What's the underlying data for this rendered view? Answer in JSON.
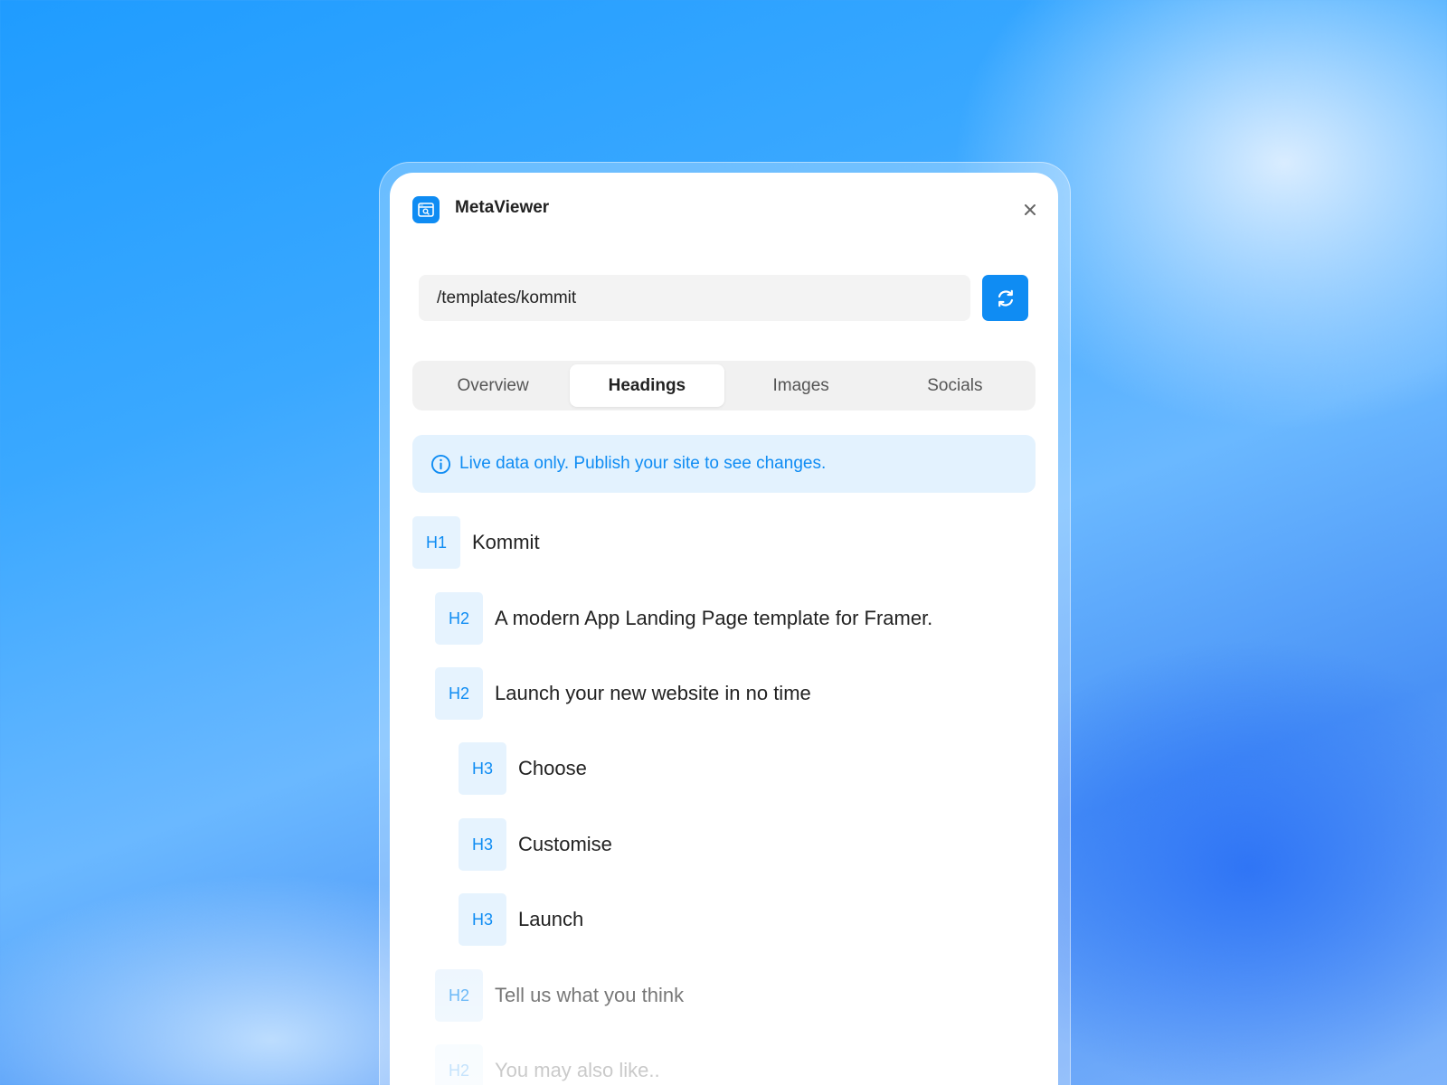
{
  "app": {
    "title": "MetaViewer",
    "icon": "browser-search-icon",
    "accent_color": "#0f8cf3"
  },
  "url_bar": {
    "value": "/templates/kommit"
  },
  "tabs": [
    {
      "label": "Overview",
      "active": false
    },
    {
      "label": "Headings",
      "active": true
    },
    {
      "label": "Images",
      "active": false
    },
    {
      "label": "Socials",
      "active": false
    }
  ],
  "banner": {
    "icon": "info-icon",
    "text": "Live data only. Publish your site to see changes."
  },
  "headings": [
    {
      "level": "H1",
      "text": "Kommit"
    },
    {
      "level": "H2",
      "text": "A modern App Landing Page template for Framer."
    },
    {
      "level": "H2",
      "text": "Launch your new website in no time"
    },
    {
      "level": "H3",
      "text": "Choose"
    },
    {
      "level": "H3",
      "text": "Customise"
    },
    {
      "level": "H3",
      "text": "Launch"
    },
    {
      "level": "H2",
      "text": "Tell us what you think"
    },
    {
      "level": "H2",
      "text": "You may also like.."
    }
  ]
}
